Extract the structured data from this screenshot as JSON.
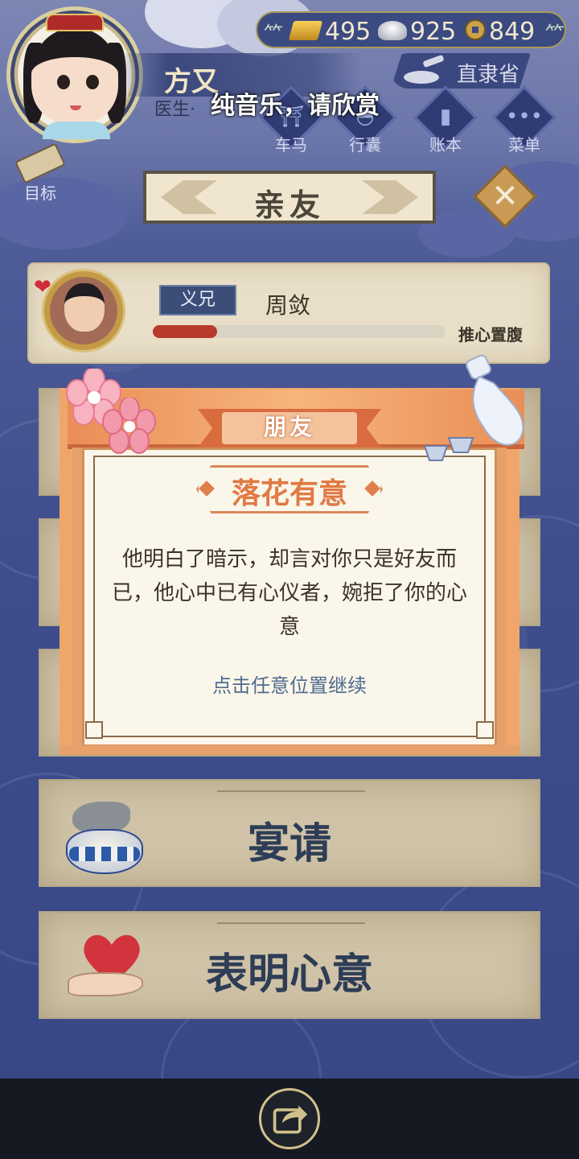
{
  "hud": {
    "player_name": "方又",
    "player_title": "医生·",
    "overlay_caption": "纯音乐，请欣赏",
    "currency": {
      "gold": "495",
      "silver": "925",
      "coins": "849"
    },
    "region": "直隶省",
    "menu": [
      {
        "label": "车马",
        "icon": "carriage-icon"
      },
      {
        "label": "行囊",
        "icon": "bag-icon"
      },
      {
        "label": "账本",
        "icon": "ledger-icon"
      },
      {
        "label": "菜单",
        "icon": "more-icon"
      }
    ],
    "goal_label": "目标"
  },
  "panel": {
    "title": "亲友",
    "close_icon": "close-icon"
  },
  "friend": {
    "relation_tag": "义兄",
    "name": "周敛",
    "status": "推心置腹",
    "affinity": 0.22,
    "hearts_icon": "hearts-icon"
  },
  "options": [
    {
      "label": "宴请",
      "icon": "fish-jar-icon"
    },
    {
      "label": "表明心意",
      "icon": "heart-in-hand-icon"
    }
  ],
  "dialog": {
    "header": "朋友",
    "title": "落花有意",
    "message": "他明白了暗示，却言对你只是好友而已，他心中已有心仪者，婉拒了你的心意",
    "hint": "点击任意位置继续"
  },
  "bottom": {
    "share_icon": "share-icon"
  },
  "colors": {
    "background": "#3f4d8c",
    "dialog_accent": "#e07a44",
    "option_text": "#2e3d57",
    "bar_fill": "#b73a2c"
  }
}
